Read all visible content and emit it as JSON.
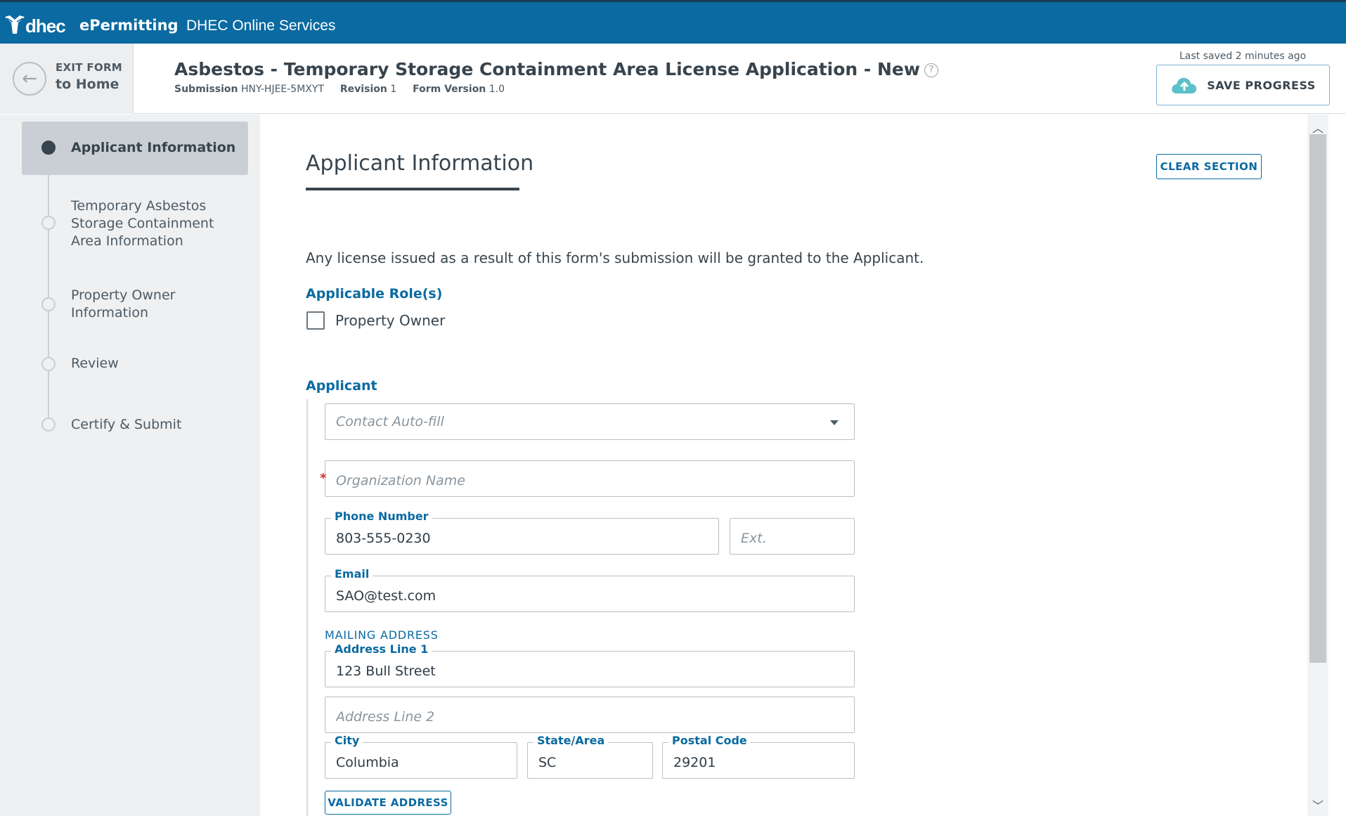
{
  "topbar": {
    "logo_text": "dhec",
    "app_name": "ePermitting",
    "online_services": "DHEC Online Services"
  },
  "header": {
    "exit_line1": "EXIT FORM",
    "exit_line2": "to Home",
    "title": "Asbestos - Temporary Storage Containment Area License Application - New",
    "submission_label": "Submission",
    "submission_id": "HNY-HJEE-5MXYT",
    "revision_label": "Revision",
    "revision_value": "1",
    "form_version_label": "Form Version",
    "form_version_value": "1.0",
    "last_saved": "Last saved 2 minutes ago",
    "save_label": "SAVE PROGRESS"
  },
  "sidebar": {
    "steps": [
      {
        "label": "Applicant Information",
        "active": true
      },
      {
        "label": "Temporary Asbestos Storage Containment Area Information",
        "active": false
      },
      {
        "label": "Property Owner Information",
        "active": false
      },
      {
        "label": "Review",
        "active": false
      },
      {
        "label": "Certify & Submit",
        "active": false
      }
    ]
  },
  "main": {
    "section_title": "Applicant Information",
    "clear_label": "CLEAR SECTION",
    "intro": "Any license issued as a result of this form's submission will be granted to the Applicant.",
    "roles_label": "Applicable Role(s)",
    "role_property_owner": "Property Owner",
    "role_property_owner_checked": false,
    "applicant_label": "Applicant",
    "contact_autofill_placeholder": "Contact Auto-fill",
    "org_name_placeholder": "Organization Name",
    "phone_label": "Phone Number",
    "phone_value": "803-555-0230",
    "ext_placeholder": "Ext.",
    "email_label": "Email",
    "email_value": "SAO@test.com",
    "mailing_address": "MAILING ADDRESS",
    "address1_label": "Address Line 1",
    "address1_value": "123 Bull Street",
    "address2_placeholder": "Address Line 2",
    "city_label": "City",
    "city_value": "Columbia",
    "state_label": "State/Area",
    "state_value": "SC",
    "postal_label": "Postal Code",
    "postal_value": "29201",
    "validate_label": "VALIDATE ADDRESS"
  },
  "colors": {
    "topbar": "#0a6aa1",
    "accent": "#0a6aa1",
    "required": "#d0312d",
    "sidebar_bg": "#eef0f2"
  }
}
